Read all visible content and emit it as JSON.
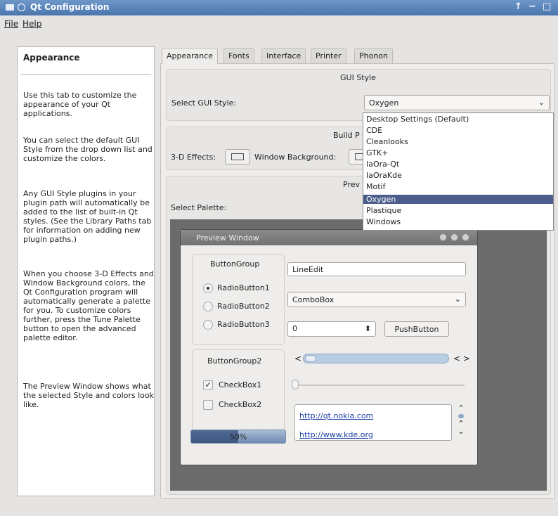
{
  "window": {
    "title": "Qt Configuration",
    "buttons": {
      "up": "↑",
      "minimize": "−",
      "maximize": "□"
    }
  },
  "menubar": {
    "file": "File",
    "help": "Help"
  },
  "left_panel": {
    "title": "Appearance",
    "paragraphs": [
      "Use this tab to customize the appearance of your Qt applications.",
      "You can select the default GUI Style from the drop down list and customize the colors.",
      "Any GUI Style plugins in your plugin path will automatically be added to the list of built-in Qt styles. (See the Library Paths tab for information on adding new plugin paths.)",
      "When you choose 3-D Effects and Window Background colors, the Qt Configuration program will automatically generate a palette for you. To customize colors further, press the Tune Palette button to open the advanced palette editor.",
      "The Preview Window shows what the selected Style and colors look like."
    ]
  },
  "tabs": [
    "Appearance",
    "Fonts",
    "Interface",
    "Printer",
    "Phonon"
  ],
  "gui_style": {
    "group_title": "GUI Style",
    "select_label": "Select GUI Style:",
    "selected": "Oxygen",
    "options": [
      "Desktop Settings (Default)",
      "CDE",
      "Cleanlooks",
      "GTK+",
      "IaOra-Qt",
      "IaOraKde",
      "Motif",
      "Oxygen",
      "Plastique",
      "Windows"
    ]
  },
  "build_palette": {
    "group_title": "Build P",
    "effects_label": "3-D Effects:",
    "window_bg_label": "Window Background:"
  },
  "preview": {
    "group_title": "Prev",
    "select_palette_label": "Select Palette:",
    "window_title": "Preview Window",
    "button_group1": "ButtonGroup",
    "radio1": "RadioButton1",
    "radio2": "RadioButton2",
    "radio3": "RadioButton3",
    "button_group2": "ButtonGroup2",
    "checkbox1": "CheckBox1",
    "checkbox2": "CheckBox2",
    "progress_text": "50%",
    "progress_value": 0.5,
    "line_edit": "LineEdit",
    "combo": "ComboBox",
    "spin_value": "0",
    "push_button": "PushButton",
    "link1": "http://qt.nokia.com",
    "link2": "http://www.kde.org"
  },
  "icons": {
    "chevron": "⌄",
    "spin": "⬍",
    "check": "✓",
    "scroll_left": "<",
    "scroll_right": ">",
    "scroll_up": "⌃",
    "scroll_down": "⌄"
  }
}
